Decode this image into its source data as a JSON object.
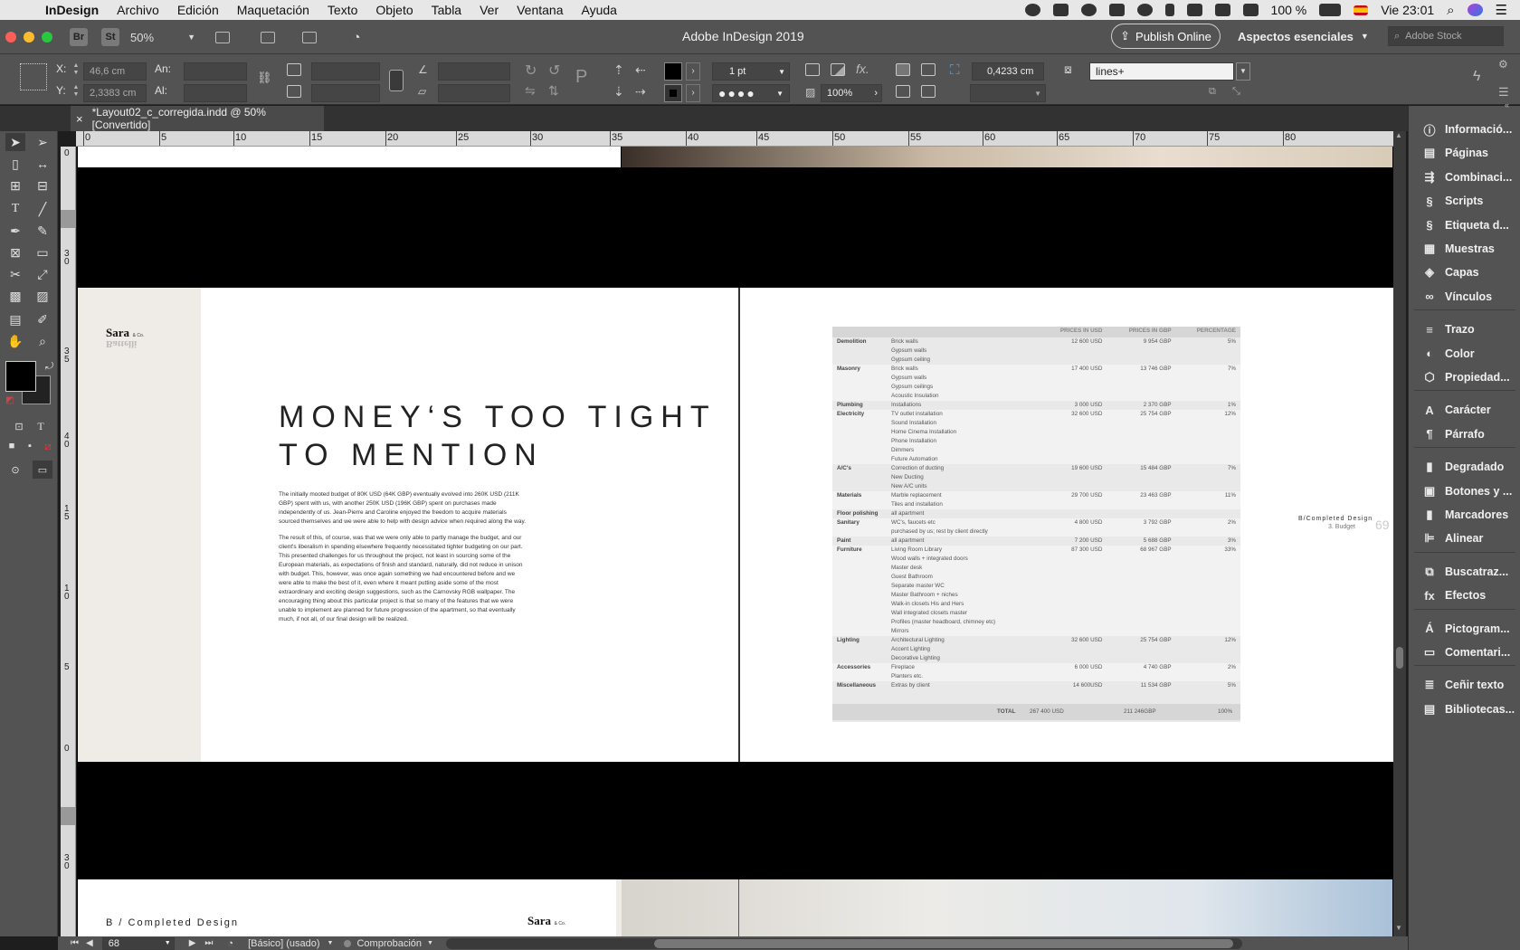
{
  "menubar": {
    "app": "InDesign",
    "items": [
      "Archivo",
      "Edición",
      "Maquetación",
      "Texto",
      "Objeto",
      "Tabla",
      "Ver",
      "Ventana",
      "Ayuda"
    ],
    "battery": "100 %",
    "clock": "Vie 23:01"
  },
  "appbar": {
    "zoom": "50%",
    "title": "Adobe InDesign 2019",
    "publish": "Publish Online",
    "workspace": "Aspectos esenciales",
    "stock_placeholder": "Adobe Stock",
    "br": "Br",
    "st": "St"
  },
  "controlbar": {
    "x_label": "X:",
    "x_value": "46,6 cm",
    "y_label": "Y:",
    "y_value": "2,3383 cm",
    "w_label": "An:",
    "h_label": "Al:",
    "stroke": "1 pt",
    "scale": "100%",
    "spacing": "0,4233 cm",
    "object_style": "lines+"
  },
  "doc": {
    "tab": "*Layout02_c_corregida.indd @ 50% [Convertido]"
  },
  "ruler": {
    "h": [
      "0",
      "5",
      "10",
      "15",
      "20",
      "25",
      "30",
      "35",
      "40",
      "45",
      "50",
      "55",
      "60",
      "65",
      "70",
      "75",
      "80"
    ],
    "v": [
      "0",
      "3\n0",
      "3\n5",
      "4\n0",
      "1\n5",
      "1\n0",
      "5",
      "0",
      "3\n0"
    ]
  },
  "page": {
    "logo": "Sara",
    "logo_sub": "& Co.",
    "logo_mirror": "Battelli",
    "heading1": "MONEY‘S TOO TIGHT",
    "heading2": "TO MENTION",
    "para1": "The initially mooted budget of 80K USD (64K GBP) eventually evolved into 260K USD (211K GBP) spent with us, with another 250K USD (196K GBP) spent on purchases made independently of us. Jean-Pierre and Caroline enjoyed the freedom to acquire materials sourced themselves and we were able to help with design advice when required along the way.",
    "para2": "The result of this, of course, was that we were only able to partly manage the budget, and our client's liberalism in spending elsewhere frequently necessitated tighter budgeting on our part. This presented challenges for us throughout the project, not least in sourcing some of the European materials, as expectations of finish and standard, naturally, did not reduce in unison with budget. This, however, was once again something we had encountered before and we were able to make the best of it, even where it meant putting aside some of the most extraordinary and exciting design suggestions, such as the Carnovsky RGB wallpaper. The encouraging thing about this particular project is that so many of the features that we were unable to implement are planned for future progression of the apartment, so that eventually much, if not all, of our final design will be realized.",
    "side_title": "B/Completed Design",
    "side_sub": "3. Budget",
    "page_num": "69",
    "bottom_title": "B / Completed Design",
    "bottom_logo": "Sara"
  },
  "table": {
    "headers": [
      "",
      "",
      "PRICES IN USD",
      "PRICES IN GBP",
      "PERCENTAGE"
    ],
    "rows": [
      {
        "cat": "Demolition",
        "items": [
          "Brick walls",
          "Gypsum walls",
          "Gypsum ceiling"
        ],
        "usd": "12 600 USD",
        "gbp": "9 954 GBP",
        "pct": "5%"
      },
      {
        "cat": "Masonry",
        "items": [
          "Brick walls",
          "Gypsum walls",
          "Gypsum ceilings",
          "Acoustic Insulation"
        ],
        "usd": "17 400 USD",
        "gbp": "13 746 GBP",
        "pct": "7%"
      },
      {
        "cat": "Plumbing",
        "items": [
          "Installations"
        ],
        "usd": "3 000 USD",
        "gbp": "2 370 GBP",
        "pct": "1%"
      },
      {
        "cat": "Electricity",
        "items": [
          "TV outlet installation",
          "Sound Installation",
          "Home Cinema Installation",
          "Phone Installation",
          "Dimmers",
          "Future Automation"
        ],
        "usd": "32 600 USD",
        "gbp": "25 754 GBP",
        "pct": "12%"
      },
      {
        "cat": "A/C's",
        "items": [
          "Correction of ducting",
          "New Ducting",
          "New A/C units"
        ],
        "usd": "19 600 USD",
        "gbp": "15 484 GBP",
        "pct": "7%"
      },
      {
        "cat": "Materials",
        "items": [
          "Marble replacement",
          "Tiles and installation"
        ],
        "usd": "29 700 USD",
        "gbp": "23 463 GBP",
        "pct": "11%"
      },
      {
        "cat": "Floor polishing",
        "items": [
          "all apartment"
        ],
        "usd": "",
        "gbp": "",
        "pct": ""
      },
      {
        "cat": "Sanitary",
        "items": [
          "WC's, faucets etc",
          "purchased by us; rest by client directly"
        ],
        "usd": "4 800 USD",
        "gbp": "3 792 GBP",
        "pct": "2%"
      },
      {
        "cat": "Paint",
        "items": [
          "all apartment"
        ],
        "usd": "7 200 USD",
        "gbp": "5 688 GBP",
        "pct": "3%"
      },
      {
        "cat": "Furniture",
        "items": [
          "Living Room Library",
          "Wood walls + integrated doors",
          "Master desk",
          "Guest Bathroom",
          "Separate master WC",
          "Master Bathroom + niches",
          "Walk-in closets His and Hers",
          "Wall integrated closets master",
          "Profiles (master headboard, chimney etc)",
          "Mirrors"
        ],
        "usd": "87 300 USD",
        "gbp": "68 967 GBP",
        "pct": "33%"
      },
      {
        "cat": "Lighting",
        "items": [
          "Architectural Lighting",
          "Accent Lighting",
          "Decorative Lighting"
        ],
        "usd": "32 600 USD",
        "gbp": "25 754 GBP",
        "pct": "12%"
      },
      {
        "cat": "Accessories",
        "items": [
          "Fireplace",
          "Planters etc."
        ],
        "usd": "6 000 USD",
        "gbp": "4 740 GBP",
        "pct": "2%"
      },
      {
        "cat": "Miscellaneous",
        "items": [
          "Extras by client"
        ],
        "usd": "14 600USD",
        "gbp": "11 534 GBP",
        "pct": "5%"
      }
    ],
    "total": {
      "label": "TOTAL",
      "usd": "267 400 USD",
      "gbp": "211 246GBP",
      "pct": "100%"
    }
  },
  "panels": [
    {
      "icon": "info-icon",
      "glyph": "ⓘ",
      "label": "Informació..."
    },
    {
      "icon": "pages-icon",
      "glyph": "▤",
      "label": "Páginas"
    },
    {
      "icon": "merge-icon",
      "glyph": "⇶",
      "label": "Combinaci..."
    },
    {
      "icon": "scripts-icon",
      "glyph": "§",
      "label": "Scripts"
    },
    {
      "icon": "script-label-icon",
      "glyph": "§",
      "label": "Etiqueta d..."
    },
    {
      "icon": "swatches-icon",
      "glyph": "▦",
      "label": "Muestras"
    },
    {
      "icon": "layers-icon",
      "glyph": "◈",
      "label": "Capas"
    },
    {
      "icon": "links-icon",
      "glyph": "∞",
      "label": "Vínculos"
    },
    {
      "icon": "stroke-icon",
      "glyph": "≡",
      "label": "Trazo"
    },
    {
      "icon": "color-icon",
      "glyph": "◐",
      "label": "Color"
    },
    {
      "icon": "properties-icon",
      "glyph": "⬡",
      "label": "Propiedad..."
    },
    {
      "icon": "character-icon",
      "glyph": "A",
      "label": "Carácter"
    },
    {
      "icon": "paragraph-icon",
      "glyph": "¶",
      "label": "Párrafo"
    },
    {
      "icon": "gradient-icon",
      "glyph": "▮",
      "label": "Degradado"
    },
    {
      "icon": "buttons-icon",
      "glyph": "▣",
      "label": "Botones y ..."
    },
    {
      "icon": "bookmarks-icon",
      "glyph": "▮",
      "label": "Marcadores"
    },
    {
      "icon": "align-icon",
      "glyph": "⊫",
      "label": "Alinear"
    },
    {
      "icon": "find-icon",
      "glyph": "⧉",
      "label": "Buscatraz..."
    },
    {
      "icon": "effects-icon",
      "glyph": "fx",
      "label": "Efectos"
    },
    {
      "icon": "glyphs-icon",
      "glyph": "Á",
      "label": "Pictogram..."
    },
    {
      "icon": "comments-icon",
      "glyph": "▭",
      "label": "Comentari..."
    },
    {
      "icon": "text-wrap-icon",
      "glyph": "≣",
      "label": "Ceñir texto"
    },
    {
      "icon": "libraries-icon",
      "glyph": "▤",
      "label": "Bibliotecas..."
    }
  ],
  "status": {
    "page": "68",
    "style": "[Básico] (usado)",
    "preflight": "Comprobación"
  }
}
